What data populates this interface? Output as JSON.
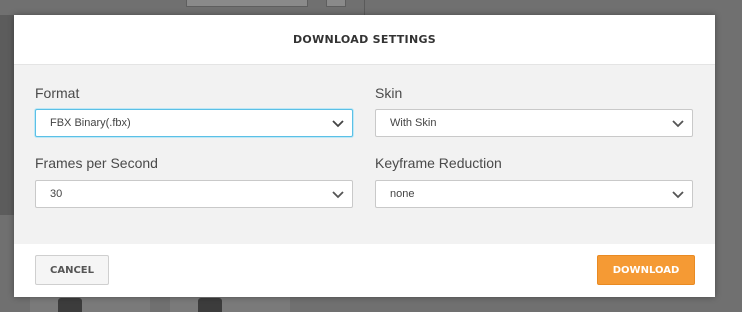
{
  "dialog": {
    "title": "DOWNLOAD SETTINGS"
  },
  "fields": {
    "format": {
      "label": "Format",
      "value": "FBX Binary(.fbx)"
    },
    "skin": {
      "label": "Skin",
      "value": "With Skin"
    },
    "fps": {
      "label": "Frames per Second",
      "value": "30"
    },
    "keyframe_reduction": {
      "label": "Keyframe Reduction",
      "value": "none"
    }
  },
  "buttons": {
    "cancel": "CANCEL",
    "download": "DOWNLOAD"
  },
  "colors": {
    "accent": "#f59a34",
    "focus_border": "#5bc0e6",
    "overlay": "#707070"
  },
  "icons": {
    "select_indicator": "chevron-down-icon"
  }
}
